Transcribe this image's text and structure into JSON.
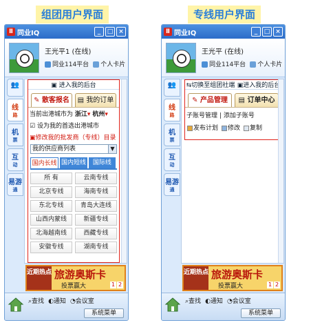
{
  "headings": {
    "left": "组团用户界面",
    "right": "专线用户界面"
  },
  "window": {
    "title": "同业IQ",
    "min": "_",
    "max": "□",
    "close": "×"
  },
  "profile": {
    "name": "王光平1 (在线)",
    "platform": "同业114平台",
    "card": "个人卡片"
  },
  "profile_right": {
    "name": "王光平 (在线)",
    "platform": "同业114平台",
    "card": "个人卡片"
  },
  "side_tabs": [
    {
      "label": "线",
      "sub": "路"
    },
    {
      "label": "机",
      "sub": "票"
    },
    {
      "label": "互",
      "sub": "动"
    },
    {
      "label": "易游",
      "sub": "通"
    }
  ],
  "left": {
    "backend": "进入我的后台",
    "tabs": [
      "散客报名",
      "我的订单"
    ],
    "city_label": "当前出港城市为",
    "city_from": "浙江",
    "city_to": "杭州",
    "default_checkbox": "设为我的首选出港城市",
    "edit_dir": "修改我的批发商（专线）目录",
    "supplier_list": "我的供应商列表",
    "sub_tabs": [
      "国内长线",
      "国内短线",
      "国际线"
    ],
    "routes": [
      "所 有",
      "云南专线",
      "北京专线",
      "海南专线",
      "东北专线",
      "青岛大连线",
      "山西内蒙线",
      "新疆专线",
      "北海越南线",
      "西藏专线",
      "安徽专线",
      "湖南专线"
    ]
  },
  "right": {
    "switch": "切换至组团社端",
    "backend": "进入我的后台",
    "tabs": [
      "产品管理",
      "订单中心"
    ],
    "sub_links": [
      "子账号管理",
      "添加子账号"
    ],
    "sub_sep": "|",
    "tools": [
      "发布计划",
      "修改",
      "复制"
    ]
  },
  "banner": {
    "left": "近期热点",
    "big": "旅游奥斯卡",
    "sub": "投票赢大",
    "pages": [
      "1",
      "2"
    ]
  },
  "bottom": {
    "buttons": [
      "查找",
      "通知",
      "会议室"
    ],
    "menu": "系统菜单"
  }
}
